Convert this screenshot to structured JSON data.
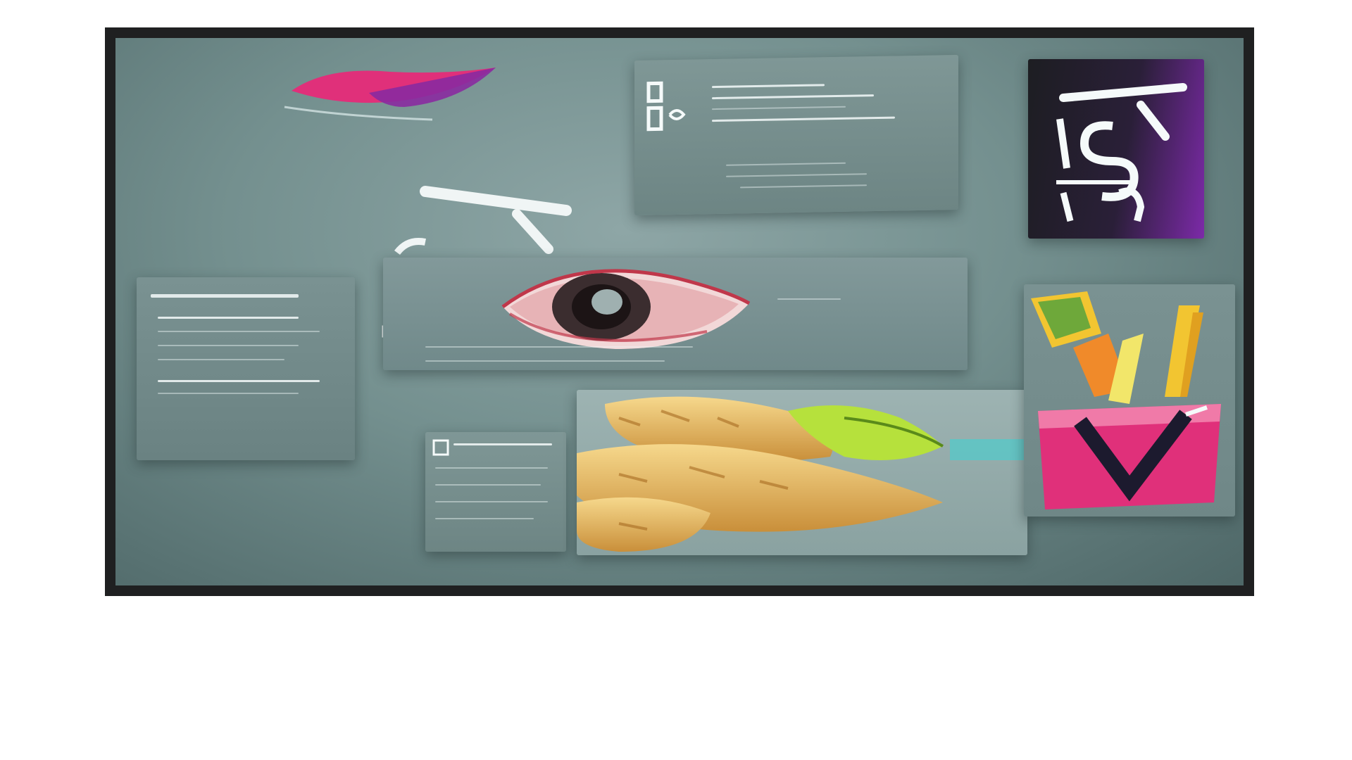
{
  "artwork": {
    "description_tag": "abstract-collage",
    "colors": {
      "frame": "#1f2021",
      "background": "#6f8a89",
      "panel": "#7a9292",
      "accent_magenta": "#e0307a",
      "accent_purple": "#7c2aa8",
      "accent_yellow": "#f2c531",
      "accent_lime": "#b6e13c",
      "text_white": "#f5fafa"
    },
    "icons": [
      "brush-stroke-icon",
      "eye-icon",
      "pencil-cup-icon",
      "check-mark-icon",
      "letter-glyph-icon"
    ]
  }
}
